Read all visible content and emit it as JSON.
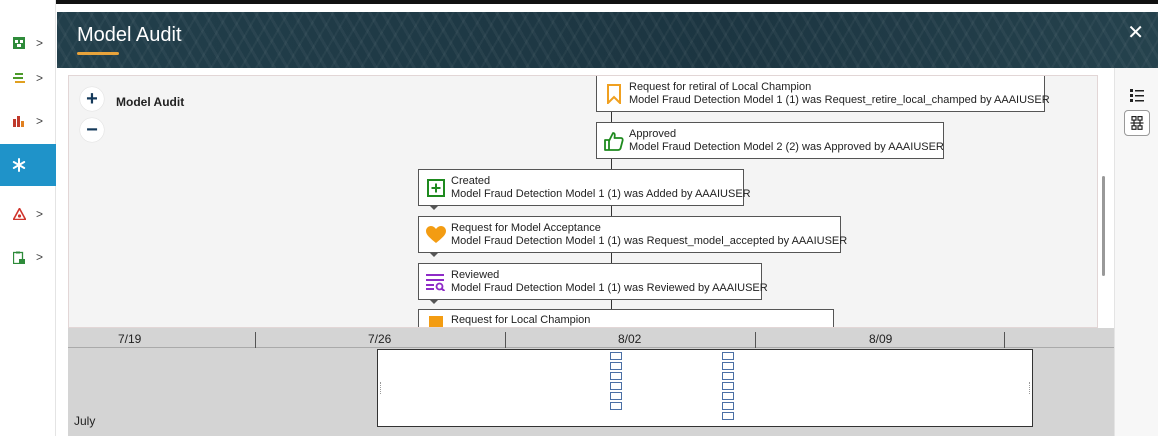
{
  "window": {
    "title": "Model Audit",
    "close_glyph": "✕"
  },
  "rail": {
    "items": [
      {
        "icon": "model-inventory-icon",
        "color": "#2e8b3a"
      },
      {
        "icon": "list-icon",
        "color": "#4c9a2a"
      },
      {
        "icon": "chart-icon",
        "color": "#c0392b"
      },
      {
        "icon": "asterisk-icon",
        "color": "#ffffff",
        "active": true
      },
      {
        "icon": "warning-icon",
        "color": "#d0342c"
      },
      {
        "icon": "clipboard-icon",
        "color": "#2e8b3a"
      }
    ],
    "chevron": ">"
  },
  "canvas": {
    "title": "Model Audit",
    "zoom_in": "+",
    "zoom_out": "−",
    "nodes": [
      {
        "title": "Request for retiral of Local Champion",
        "detail": "Model Fraud Detection Model 1 (1) was Request_retire_local_champed by AAAIUSER",
        "icon": "bookmark-icon",
        "color": "#f0a020"
      },
      {
        "title": "Approved",
        "detail": "Model Fraud Detection Model 2 (2) was Approved by AAAIUSER",
        "icon": "thumbs-up-icon",
        "color": "#1e8a1e"
      },
      {
        "title": "Created",
        "detail": "Model Fraud Detection Model 1 (1) was Added by AAAIUSER",
        "icon": "plus-box-icon",
        "color": "#1e8a1e"
      },
      {
        "title": "Request for Model Acceptance",
        "detail": "Model Fraud Detection Model 1 (1) was Request_model_accepted by AAAIUSER",
        "icon": "heart-icon",
        "color": "#f39c12"
      },
      {
        "title": "Reviewed",
        "detail": "Model Fraud Detection Model 1 (1) was Reviewed by AAAIUSER",
        "icon": "review-list-icon",
        "color": "#8e2bc7"
      },
      {
        "title": "Request for Local Champion",
        "detail": "",
        "icon": "square-icon",
        "color": "#f39c12"
      }
    ]
  },
  "toolbar": {
    "list_view_icon": "list-view-icon",
    "hierarchy_view_icon": "hierarchy-view-icon"
  },
  "timeline": {
    "ticks": [
      "7/19",
      "7/26",
      "8/02",
      "8/09"
    ],
    "month": "July"
  }
}
